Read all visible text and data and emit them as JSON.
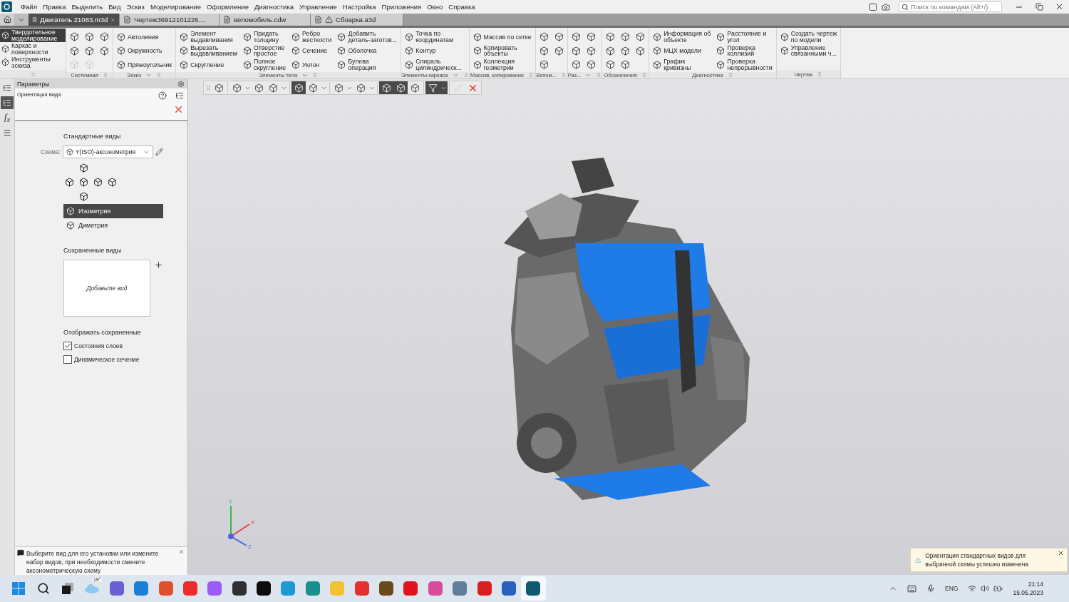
{
  "menu_bar": {
    "items": [
      "Файл",
      "Правка",
      "Выделить",
      "Вид",
      "Эскиз",
      "Моделирование",
      "Оформление",
      "Диагностика",
      "Управление",
      "Настройка",
      "Приложения",
      "Окно",
      "Справка"
    ]
  },
  "search": {
    "placeholder": "Поиск по командам (Alt+/)"
  },
  "doc_tabs": [
    {
      "label": "Двигатель 21083.m3d",
      "selected": true,
      "closable": true,
      "warning": false
    },
    {
      "label": "Чертеж36912101226....",
      "selected": false,
      "closable": false,
      "warning": false
    },
    {
      "label": "веломобиль.cdw",
      "selected": false,
      "closable": false,
      "warning": false
    },
    {
      "label": "Сбоарка.a3d",
      "selected": false,
      "closable": false,
      "warning": true
    }
  ],
  "ribbon": {
    "modes": [
      {
        "label": "Твердотельное\nмоделирование",
        "selected": true
      },
      {
        "label": "Каркас и\nповерхности",
        "selected": false
      },
      {
        "label": "Инструменты\nэскиза",
        "selected": false
      }
    ],
    "groups": [
      {
        "label": "Системная",
        "menu": false,
        "columns": [
          [
            {
              "kind": "icon",
              "disabled": false
            },
            {
              "kind": "icon",
              "disabled": false
            },
            {
              "kind": "icon",
              "disabled": true
            }
          ],
          [
            {
              "kind": "icon",
              "disabled": false
            },
            {
              "kind": "icon",
              "disabled": false
            },
            {
              "kind": "icon",
              "disabled": true
            }
          ],
          [
            {
              "kind": "icon",
              "disabled": false
            },
            {
              "kind": "icon",
              "disabled": false
            }
          ]
        ]
      },
      {
        "label": "Эскиз",
        "menu": true,
        "columns": [
          [
            {
              "kind": "labeled",
              "label": "Автолиния"
            },
            {
              "kind": "labeled",
              "label": "Окружность"
            },
            {
              "kind": "labeled",
              "label": "Прямоугольник"
            }
          ]
        ]
      },
      {
        "label": "Элементы тела",
        "menu": true,
        "columns": [
          [
            {
              "kind": "labeled",
              "label": "Элемент\nвыдавливания"
            },
            {
              "kind": "labeled",
              "label": "Вырезать\nвыдавливанием"
            },
            {
              "kind": "labeled",
              "label": "Скругление"
            }
          ],
          [
            {
              "kind": "labeled",
              "label": "Придать\nтолщину"
            },
            {
              "kind": "labeled",
              "label": "Отверстие\nпростое"
            },
            {
              "kind": "labeled",
              "label": "Полное\nскругление"
            }
          ],
          [
            {
              "kind": "labeled",
              "label": "Ребро\nжесткости"
            },
            {
              "kind": "labeled",
              "label": "Сечение"
            },
            {
              "kind": "labeled",
              "label": "Уклон"
            }
          ],
          [
            {
              "kind": "labeled",
              "label": "Добавить\nдеталь-заготов..."
            },
            {
              "kind": "labeled",
              "label": "Оболочка"
            },
            {
              "kind": "labeled",
              "label": "Булева\nоперация"
            }
          ]
        ]
      },
      {
        "label": "Элементы каркаса",
        "menu": true,
        "columns": [
          [
            {
              "kind": "labeled",
              "label": "Точка по\nкоординатам"
            },
            {
              "kind": "labeled",
              "label": "Контур"
            },
            {
              "kind": "labeled",
              "label": "Спираль\nцилиндрическ..."
            }
          ]
        ]
      },
      {
        "label": "Массив, копирование",
        "menu": false,
        "columns": [
          [
            {
              "kind": "labeled",
              "label": "Массив по сетке"
            },
            {
              "kind": "labeled",
              "label": "Копировать\nобъекты"
            },
            {
              "kind": "labeled",
              "label": "Коллекция\nгеометрии"
            }
          ]
        ]
      },
      {
        "label": "Вспом...",
        "menu": false,
        "columns": [
          [
            {
              "kind": "icon",
              "disabled": false
            },
            {
              "kind": "icon",
              "disabled": false
            },
            {
              "kind": "icon",
              "disabled": false
            }
          ],
          [
            {
              "kind": "icon",
              "disabled": false
            },
            {
              "kind": "icon",
              "disabled": false
            }
          ]
        ]
      },
      {
        "label": "Раз...",
        "menu": true,
        "columns": [
          [
            {
              "kind": "icon",
              "disabled": false
            },
            {
              "kind": "icon",
              "disabled": false
            },
            {
              "kind": "icon",
              "disabled": false
            }
          ],
          [
            {
              "kind": "icon",
              "disabled": false
            },
            {
              "kind": "icon",
              "disabled": false
            },
            {
              "kind": "icon",
              "disabled": false
            }
          ]
        ]
      },
      {
        "label": "Обозначения",
        "menu": false,
        "columns": [
          [
            {
              "kind": "icon",
              "disabled": false
            },
            {
              "kind": "icon",
              "disabled": false
            },
            {
              "kind": "icon",
              "disabled": false
            }
          ],
          [
            {
              "kind": "icon",
              "disabled": false
            },
            {
              "kind": "icon",
              "disabled": false
            },
            {
              "kind": "icon",
              "disabled": false
            }
          ],
          [
            {
              "kind": "icon",
              "disabled": false
            },
            {
              "kind": "icon",
              "disabled": false
            }
          ]
        ]
      },
      {
        "label": "Диагностика",
        "menu": false,
        "columns": [
          [
            {
              "kind": "labeled",
              "label": "Информация об\nобъекте"
            },
            {
              "kind": "labeled",
              "label": "МЦХ модели"
            },
            {
              "kind": "labeled",
              "label": "График\nкривизны"
            }
          ],
          [
            {
              "kind": "labeled",
              "label": "Расстояние и\nугол"
            },
            {
              "kind": "labeled",
              "label": "Проверка\nколлизий"
            },
            {
              "kind": "labeled",
              "label": "Проверка\nнепрерывности"
            }
          ]
        ]
      },
      {
        "label": "Чертеж",
        "menu": false,
        "columns": [
          [
            {
              "kind": "labeled",
              "label": "Создать чертеж\nпо модели"
            },
            {
              "kind": "labeled",
              "label": "Управление\nсвязанными ч..."
            }
          ]
        ]
      }
    ]
  },
  "side_strip": [
    {
      "kind": "icon",
      "selected": false
    },
    {
      "kind": "icon",
      "selected": true
    },
    {
      "kind": "text",
      "label": "f$_{x}$",
      "selected": false
    },
    {
      "kind": "icon",
      "selected": false
    }
  ],
  "panel": {
    "title": "Параметры",
    "subtitle": "Ориентация вида",
    "standard_title": "Стандартные виды",
    "scheme_label": "Схема:",
    "scheme_value": "Y(ISO)-аксонометрия",
    "views": [
      {
        "label": "Изометрия",
        "selected": true
      },
      {
        "label": "Диметрия",
        "selected": false
      }
    ],
    "saved_title": "Сохраненные виды",
    "saved_placeholder": "Добавьте вид",
    "display_title": "Отображать сохраненные",
    "options": [
      {
        "label": "Состояния слоев",
        "checked": true
      },
      {
        "label": "Динамическое сечение",
        "checked": false
      }
    ],
    "hint": "Выберите вид для его установки или измените набор видов, при необходимости смените аксонометрическую схему"
  },
  "view_toolbar": [
    {
      "kind": "button",
      "selected": false
    },
    {
      "kind": "separator"
    },
    {
      "kind": "button",
      "selected": false
    },
    {
      "kind": "caret",
      "selected": false
    },
    {
      "kind": "button",
      "selected": false
    },
    {
      "kind": "button",
      "selected": false
    },
    {
      "kind": "caret",
      "selected": false
    },
    {
      "kind": "separator"
    },
    {
      "kind": "button",
      "selected": true
    },
    {
      "kind": "button",
      "selected": false
    },
    {
      "kind": "caret",
      "selected": false
    },
    {
      "kind": "separator"
    },
    {
      "kind": "button",
      "selected": false
    },
    {
      "kind": "caret",
      "selected": false
    },
    {
      "kind": "button",
      "selected": false
    },
    {
      "kind": "caret",
      "selected": false
    },
    {
      "kind": "separator"
    },
    {
      "kind": "button",
      "selected": true
    },
    {
      "kind": "button",
      "selected": true
    },
    {
      "kind": "button",
      "selected": false
    },
    {
      "kind": "separator"
    },
    {
      "kind": "button",
      "selected": true
    },
    {
      "kind": "caret",
      "selected": true
    },
    {
      "kind": "separator"
    },
    {
      "kind": "disabled",
      "selected": false
    },
    {
      "kind": "close",
      "selected": false
    }
  ],
  "axes": [
    "Y",
    "X",
    "Z"
  ],
  "toast": {
    "text": "Ориентация стандартных видов для выбранной схемы успешно изменена"
  },
  "taskbar": {
    "weather": "19°",
    "apps": [
      {
        "kind": "start",
        "color": "#1a8ae6",
        "selected": false
      },
      {
        "kind": "search",
        "color": "#1a1a1a",
        "selected": false
      },
      {
        "kind": "taskview",
        "color": "#1a1a1a",
        "selected": false
      },
      {
        "kind": "weather",
        "color": "#8ec8f0",
        "selected": false
      },
      {
        "kind": "app",
        "color": "#6b5fd3",
        "selected": false
      },
      {
        "kind": "app",
        "color": "#1b7fd8",
        "selected": false
      },
      {
        "kind": "app",
        "color": "#e0502a",
        "selected": false
      },
      {
        "kind": "app",
        "color": "#f02b2b",
        "selected": false
      },
      {
        "kind": "app",
        "color": "#9a5cf5",
        "selected": false
      },
      {
        "kind": "app",
        "color": "#303030",
        "selected": false
      },
      {
        "kind": "app",
        "color": "#0c0c0c",
        "selected": false
      },
      {
        "kind": "app",
        "color": "#1d9bd1",
        "selected": false
      },
      {
        "kind": "app",
        "color": "#1a8f8f",
        "selected": false
      },
      {
        "kind": "app",
        "color": "#f2c230",
        "selected": false
      },
      {
        "kind": "app",
        "color": "#e53030",
        "selected": false
      },
      {
        "kind": "app",
        "color": "#6a4a1a",
        "selected": false
      },
      {
        "kind": "app",
        "color": "#e0141e",
        "selected": false
      },
      {
        "kind": "app",
        "color": "#d94c9a",
        "selected": false
      },
      {
        "kind": "app",
        "color": "#607d9a",
        "selected": false
      },
      {
        "kind": "app",
        "color": "#d81e1e",
        "selected": false
      },
      {
        "kind": "app",
        "color": "#2b5fbf",
        "selected": false
      },
      {
        "kind": "app",
        "color": "#0e5a6e",
        "selected": true
      }
    ],
    "language": "ENG",
    "time": "21:14",
    "date": "15.05.2023"
  }
}
